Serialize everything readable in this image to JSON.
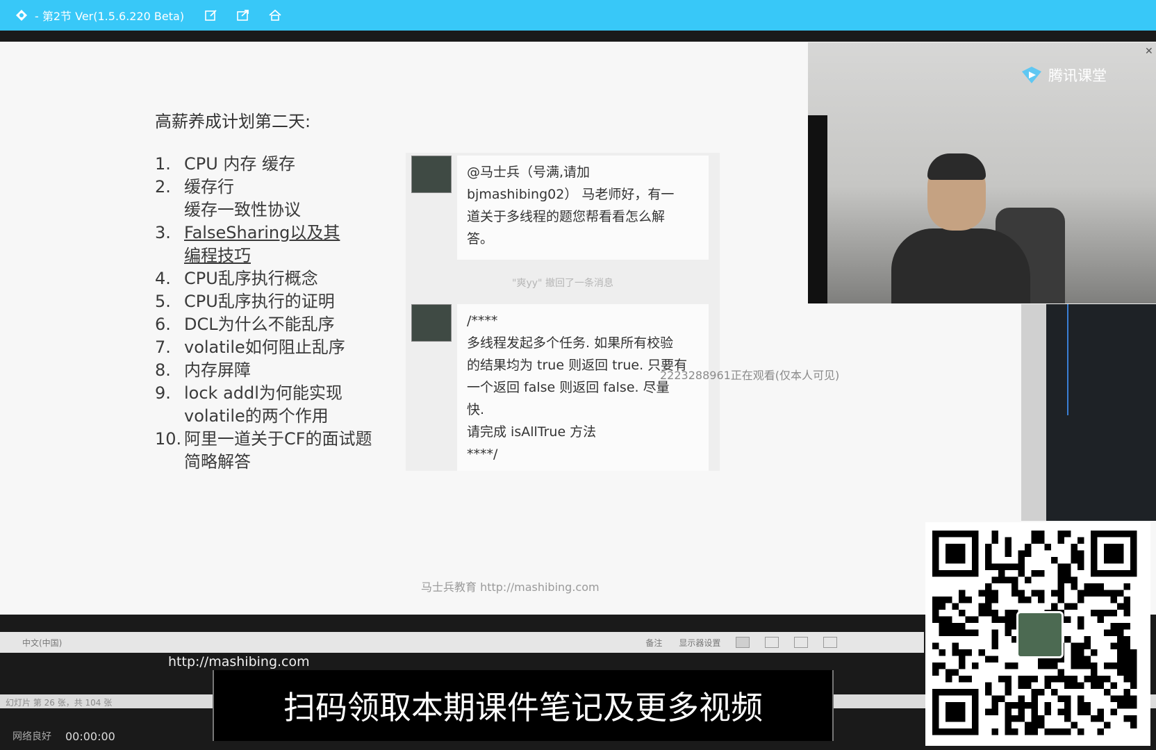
{
  "titlebar": {
    "title": "- 第2节 Ver(1.5.6.220 Beta)",
    "icons": [
      "logo-icon",
      "edit-icon",
      "share-icon",
      "home-icon"
    ]
  },
  "slide": {
    "heading": "高薪养成计划第二天:",
    "items": [
      {
        "num": "1.",
        "text": "CPU 内存 缓存"
      },
      {
        "num": "2.",
        "text": "缓存行\n缓存一致性协议"
      },
      {
        "num": "3.",
        "text": "FalseSharing以及其\n编程技巧"
      },
      {
        "num": "4.",
        "text": "CPU乱序执行概念"
      },
      {
        "num": "5.",
        "text": "CPU乱序执行的证明"
      },
      {
        "num": "6.",
        "text": "DCL为什么不能乱序"
      },
      {
        "num": "7.",
        "text": "volatile如何阻止乱序"
      },
      {
        "num": "8.",
        "text": "内存屏障"
      },
      {
        "num": "9.",
        "text": "lock addl为何能实现\nvolatile的两个作用"
      },
      {
        "num": "10.",
        "text": "阿里一道关于CF的面试题\n简略解答"
      }
    ],
    "footer_url": "马士兵教育 http://mashibing.com"
  },
  "chat": {
    "message1": "@马士兵（号满,请加\nbjmashibing02） 马老师好，有一\n道关于多线程的题您帮看看怎么解\n答。",
    "notice": "\"爽yy\" 撤回了一条消息",
    "message2": "/****\n多线程发起多个任务. 如果所有校验\n的结果均为 true 则返回 true. 只要有\n一个返回 false 则返回 false. 尽量\n快.\n请完成 isAllTrue 方法\n****/"
  },
  "watermark": "2223288961正在观看(仅本人可见)",
  "statusbar": {
    "lang": "中文(中国)",
    "notes": "备注",
    "display_settings": "显示器设置"
  },
  "strip": {
    "slide_info": "幻灯片 第 26 张，共 104 张"
  },
  "overlay_url": "http://mashibing.com",
  "promo": "扫码领取本期课件笔记及更多视频",
  "bottombar": {
    "signal": "网络良好",
    "time": "00:00:00"
  },
  "video": {
    "brand": "腾讯课堂"
  },
  "colors": {
    "titlebar": "#38c8f8",
    "slide_bg": "#f7f7f7",
    "chat_bg": "#eeeeee"
  }
}
